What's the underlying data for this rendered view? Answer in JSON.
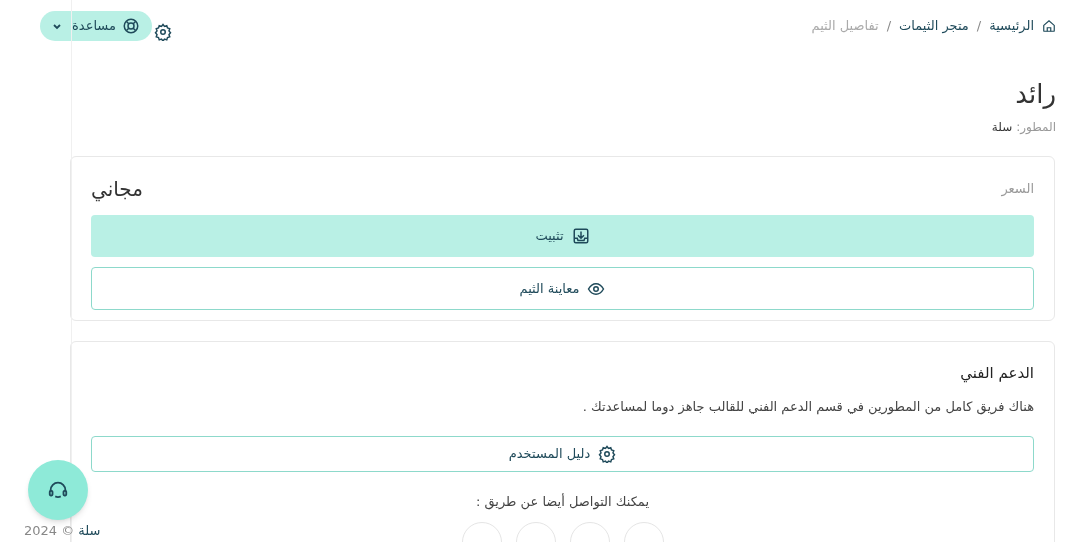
{
  "header": {
    "breadcrumb": [
      {
        "label": "الرئيسية",
        "current": false
      },
      {
        "label": "متجر الثيمات",
        "current": false
      },
      {
        "label": "تفاصيل الثيم",
        "current": true
      }
    ],
    "separator": "/",
    "help_menu": {
      "label": "مساعدة",
      "expanded": false
    }
  },
  "theme": {
    "title": "رائد",
    "developer_label": "المطور:",
    "developer": "سلة"
  },
  "price_card": {
    "label": "السعر",
    "price": "مجاني",
    "buttons": [
      {
        "label": "تثبيت",
        "kind": "primary"
      },
      {
        "label": "معاينة الثيم",
        "kind": "outline"
      }
    ]
  },
  "support_card": {
    "title": "الدعم الفني",
    "text": "هناك فريق كامل من المطورين في قسم الدعم الفني للقالب جاهز دوما لمساعدتك .",
    "guide_button": "دليل المستخدم",
    "contact_text": "يمكنك التواصل أيضا عن طريق :"
  },
  "footer": {
    "brand": "سلة",
    "copyright": "© 2024"
  }
}
